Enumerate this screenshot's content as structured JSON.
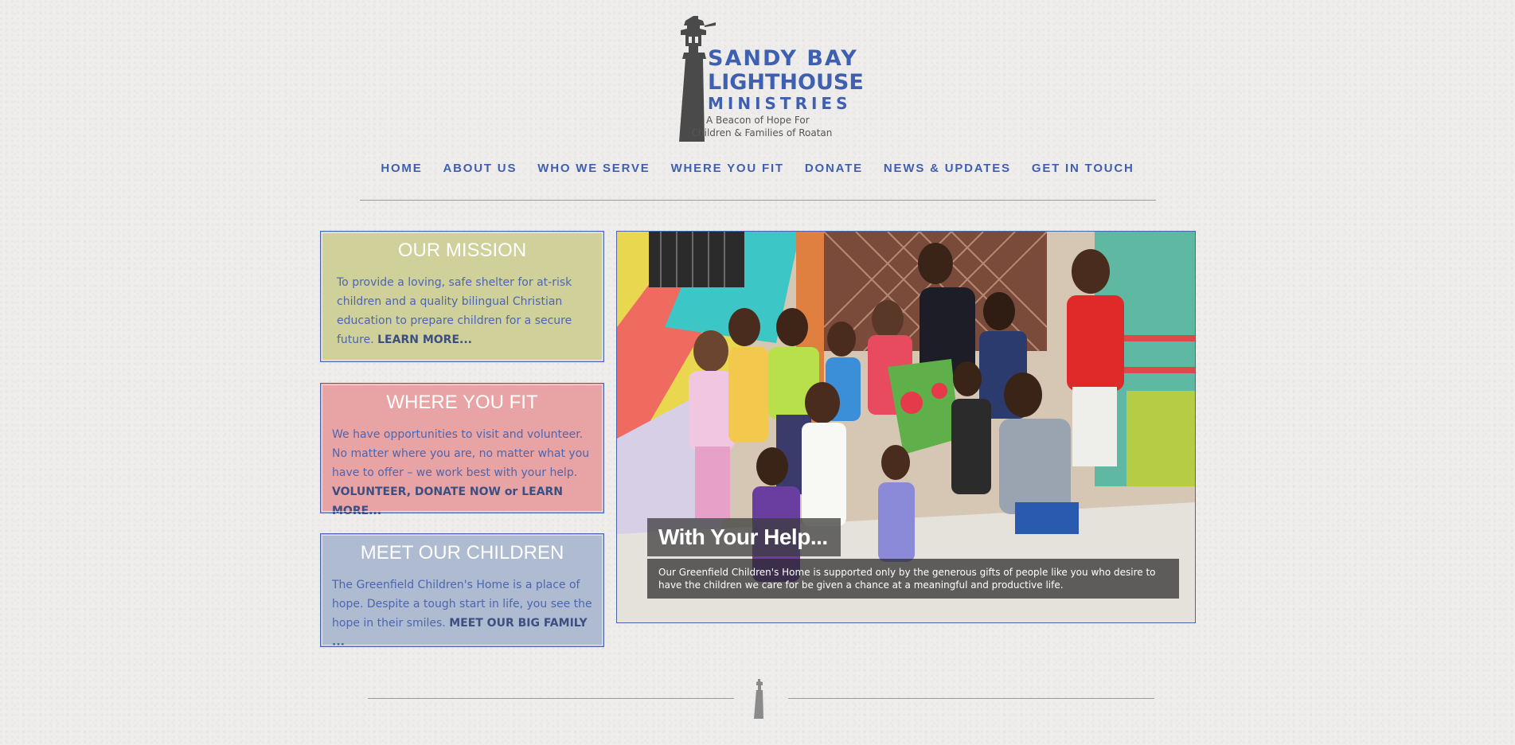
{
  "brand": {
    "line1": "SANDY BAY",
    "line2": "LIGHTHOUSE",
    "line3": "MINISTRIES",
    "tagline1": "A Beacon of Hope For",
    "tagline2": "Children & Families of Roatan",
    "logo_icon": "lighthouse-icon",
    "primary_color": "#3f5fb0"
  },
  "nav": {
    "items": [
      {
        "label": "HOME"
      },
      {
        "label": "ABOUT US"
      },
      {
        "label": "WHO WE SERVE"
      },
      {
        "label": "WHERE YOU FIT"
      },
      {
        "label": "DONATE"
      },
      {
        "label": "NEWS & UPDATES"
      },
      {
        "label": "GET IN TOUCH"
      }
    ]
  },
  "cards": {
    "mission": {
      "title": "OUR MISSION",
      "text": "To provide a loving, safe shelter for at-risk children and a quality bilingual Christian education to prepare children for a secure future. ",
      "link": "LEARN MORE...",
      "color": "#cfd09a"
    },
    "fit": {
      "title": "WHERE YOU FIT",
      "text": "We have opportunities to visit and volunteer. No matter where you are, no matter what you have to offer – we work best with your help. ",
      "link": "VOLUNTEER, DONATE NOW or LEARN MORE...",
      "color": "#e8a3a4"
    },
    "children": {
      "title": "MEET OUR CHILDREN",
      "text": "The Greenfield Children's Home is a place of hope. Despite a tough start in life, you see the hope in their smiles. ",
      "link": "MEET OUR BIG FAMILY ...",
      "color": "#aebbd0"
    }
  },
  "slider": {
    "title": "With Your Help...",
    "text": "Our Greenfield Children's Home is supported only by the generous gifts of people like you who desire to have the children we care for be given a chance at a meaningful and productive life."
  },
  "footer": {
    "icon": "lighthouse-icon"
  }
}
